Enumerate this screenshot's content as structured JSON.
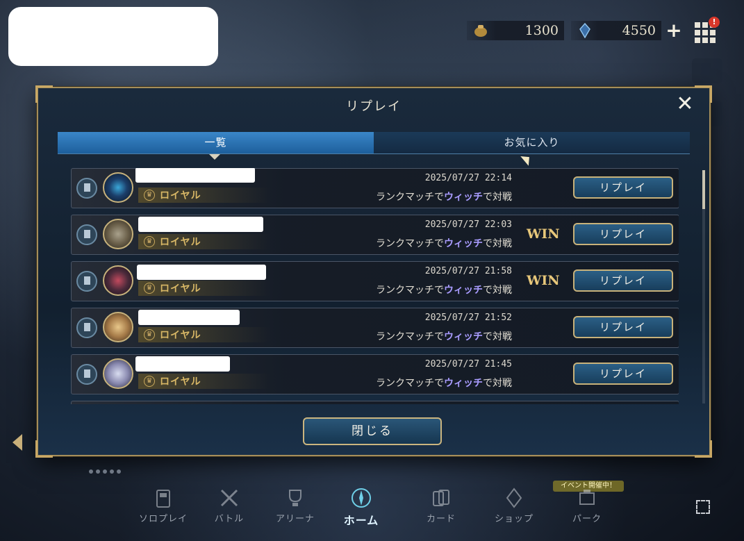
{
  "currency": {
    "gold_icon": "coin-pouch-icon",
    "gold_value": "1300",
    "crystal_icon": "crystal-icon",
    "crystal_value": "4550",
    "plus_label": "+",
    "menu_badge": "!"
  },
  "modal": {
    "title": "リプレイ",
    "close_symbol": "✕",
    "tabs": [
      {
        "label": "一覧",
        "active": true
      },
      {
        "label": "お気に入り",
        "active": false
      }
    ],
    "close_button": "閉じる"
  },
  "replays": [
    {
      "class_name": "ロイヤル",
      "date": "2025/07/27 22:14",
      "match_prefix": "ランクマッチで",
      "opponent": "ウィッチ",
      "match_suffix": "で対戦",
      "result": "",
      "button": "リプレイ"
    },
    {
      "class_name": "ロイヤル",
      "date": "2025/07/27 22:03",
      "match_prefix": "ランクマッチで",
      "opponent": "ウィッチ",
      "match_suffix": "で対戦",
      "result": "WIN",
      "button": "リプレイ"
    },
    {
      "class_name": "ロイヤル",
      "date": "2025/07/27 21:58",
      "match_prefix": "ランクマッチで",
      "opponent": "ウィッチ",
      "match_suffix": "で対戦",
      "result": "WIN",
      "button": "リプレイ"
    },
    {
      "class_name": "ロイヤル",
      "date": "2025/07/27 21:52",
      "match_prefix": "ランクマッチで",
      "opponent": "ウィッチ",
      "match_suffix": "で対戦",
      "result": "",
      "button": "リプレイ"
    },
    {
      "class_name": "ロイヤル",
      "date": "2025/07/27 21:45",
      "match_prefix": "ランクマッチで",
      "opponent": "ウィッチ",
      "match_suffix": "で対戦",
      "result": "",
      "button": "リプレイ"
    }
  ],
  "nav": [
    {
      "label": "ソロプレイ",
      "icon": "solo-play-icon",
      "active": false
    },
    {
      "label": "バトル",
      "icon": "battle-swords-icon",
      "active": false
    },
    {
      "label": "アリーナ",
      "icon": "arena-trophy-icon",
      "active": false
    },
    {
      "label": "ホーム",
      "icon": "home-compass-icon",
      "active": true
    },
    {
      "label": "カード",
      "icon": "cards-icon",
      "active": false
    },
    {
      "label": "ショップ",
      "icon": "shop-crystal-icon",
      "active": false
    },
    {
      "label": "パーク",
      "icon": "park-icon",
      "active": false
    }
  ],
  "event_badge": "イベント開催中！",
  "colors": {
    "accent_blue": "#2b6fae",
    "gold_border": "#c8b27a",
    "opponent_highlight": "#a99cff",
    "win_gold": "#e7c77a"
  }
}
